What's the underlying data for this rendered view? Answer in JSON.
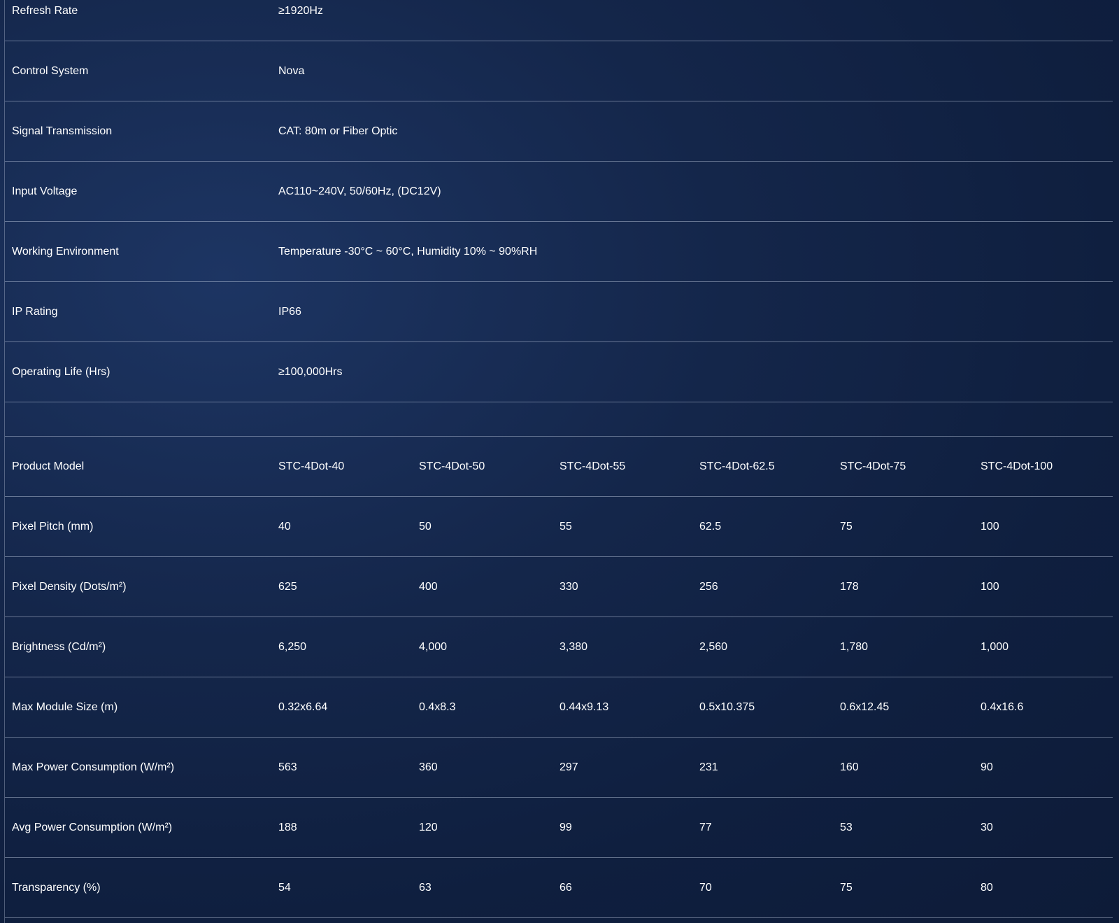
{
  "specs": [
    {
      "label": "Refresh Rate",
      "value": "≥1920Hz"
    },
    {
      "label": "Control System",
      "value": "Nova"
    },
    {
      "label": "Signal Transmission",
      "value": "CAT: 80m or Fiber Optic"
    },
    {
      "label": "Input Voltage",
      "value": "AC110~240V, 50/60Hz, (DC12V)"
    },
    {
      "label": "Working Environment",
      "value": "Temperature -30°C ~ 60°C, Humidity 10% ~ 90%RH"
    },
    {
      "label": "IP Rating",
      "value": "IP66"
    },
    {
      "label": "Operating Life (Hrs)",
      "value": "≥100,000Hrs"
    }
  ],
  "models": {
    "header": {
      "label": "Product Model",
      "cols": [
        "STC-4Dot-40",
        "STC-4Dot-50",
        "STC-4Dot-55",
        "STC-4Dot-62.5",
        "STC-4Dot-75",
        "STC-4Dot-100"
      ]
    },
    "rows": [
      {
        "label": "Pixel Pitch (mm)",
        "cols": [
          "40",
          "50",
          "55",
          "62.5",
          "75",
          "100"
        ]
      },
      {
        "label": "Pixel Density (Dots/m²)",
        "cols": [
          "625",
          "400",
          "330",
          "256",
          "178",
          "100"
        ]
      },
      {
        "label": "Brightness (Cd/m²)",
        "cols": [
          "6,250",
          "4,000",
          "3,380",
          "2,560",
          "1,780",
          "1,000"
        ]
      },
      {
        "label": "Max Module Size (m)",
        "cols": [
          "0.32x6.64",
          "0.4x8.3",
          "0.44x9.13",
          "0.5x10.375",
          "0.6x12.45",
          "0.4x16.6"
        ]
      },
      {
        "label": "Max Power Consumption (W/m²)",
        "cols": [
          "563",
          "360",
          "297",
          "231",
          "160",
          "90"
        ]
      },
      {
        "label": "Avg Power Consumption (W/m²)",
        "cols": [
          "188",
          "120",
          "99",
          "77",
          "53",
          "30"
        ]
      },
      {
        "label": "Transparency (%)",
        "cols": [
          "54",
          "63",
          "66",
          "70",
          "75",
          "80"
        ]
      }
    ]
  }
}
